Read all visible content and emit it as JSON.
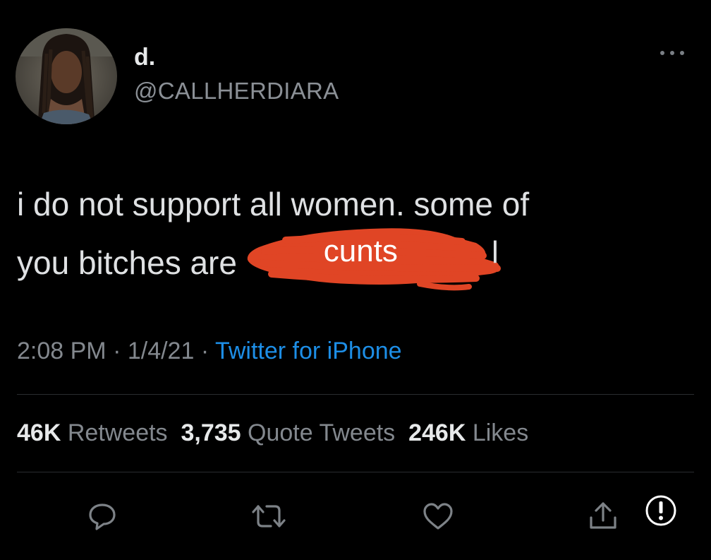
{
  "user": {
    "display_name": "d.",
    "handle": "@CALLHERDIARA"
  },
  "tweet": {
    "text_line1": "i do not support all women. some of",
    "text_line2_prefix": "you bitches are",
    "redaction_word": "cunts",
    "redaction_color": "#e04525"
  },
  "meta": {
    "time": "2:08 PM",
    "sep1": " · ",
    "date": "1/4/21",
    "sep2": " · ",
    "source": "Twitter for iPhone"
  },
  "stats": {
    "retweets_count": "46K",
    "retweets_label": "Retweets",
    "quotes_count": "3,735",
    "quotes_label": "Quote Tweets",
    "likes_count": "246K",
    "likes_label": "Likes"
  },
  "actions": [
    "reply-icon",
    "retweet-icon",
    "like-icon",
    "share-icon"
  ],
  "overlay": {
    "icon": "alert-icon"
  }
}
